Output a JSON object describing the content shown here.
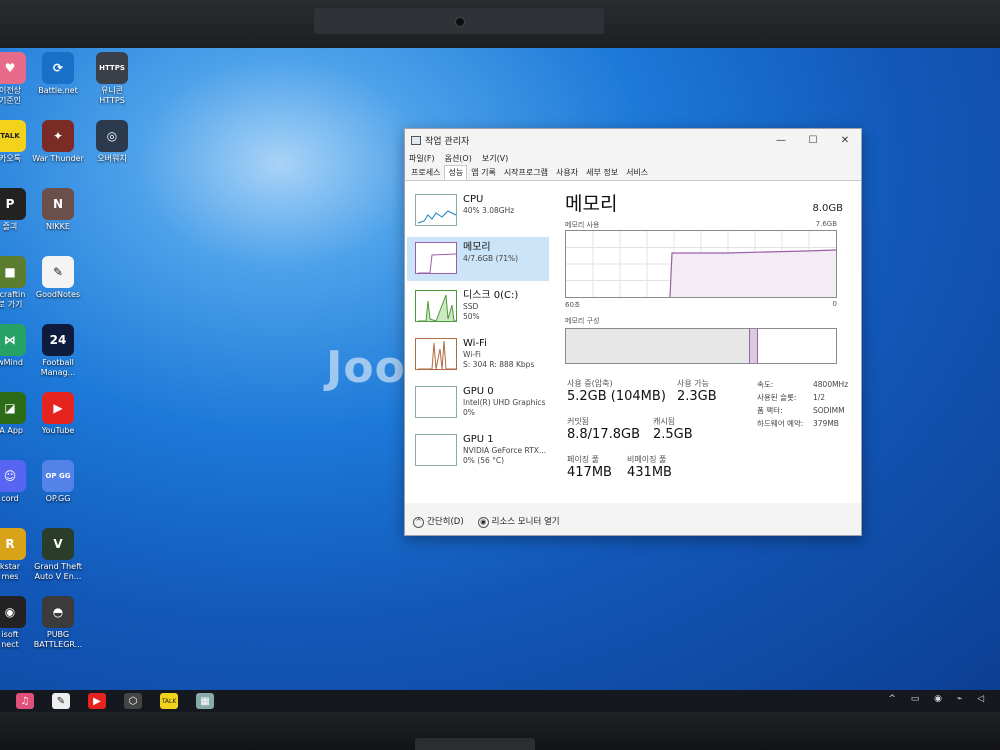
{
  "desktop": {
    "icons": [
      {
        "label": "이전상\n기준인",
        "color": "#e96b8c",
        "glyph": "♥"
      },
      {
        "label": "Battle.net",
        "color": "#1a70c6",
        "glyph": "⟳"
      },
      {
        "label": "유니콘\nHTTPS",
        "color": "#3a3f49",
        "glyph": "HTTPS"
      },
      {
        "label": "카오톡",
        "color": "#f3d21b",
        "glyph": "TALK"
      },
      {
        "label": "War Thunder",
        "color": "#7a2b25",
        "glyph": "✦"
      },
      {
        "label": "오버워치",
        "color": "#2c3a4d",
        "glyph": "◎"
      },
      {
        "label": "즐긔",
        "color": "#222",
        "glyph": "P"
      },
      {
        "label": "NIKKE",
        "color": "#6b4f4a",
        "glyph": "N"
      },
      {
        "label": "ecraftin\n로 가기",
        "color": "#5a7d2f",
        "glyph": "■"
      },
      {
        "label": "GoodNotes",
        "color": "#f4f4f4",
        "glyph": "✎"
      },
      {
        "label": "wMind",
        "color": "#26a267",
        "glyph": "⋈"
      },
      {
        "label": "Football\nManag...",
        "color": "#0f1b3d",
        "glyph": "24"
      },
      {
        "label": "IA App",
        "color": "#2c6b18",
        "glyph": "◪"
      },
      {
        "label": "YouTube",
        "color": "#e52420",
        "glyph": "▶"
      },
      {
        "label": "cord",
        "color": "#5865f2",
        "glyph": "☺"
      },
      {
        "label": "OP.GG",
        "color": "#5383e8",
        "glyph": "OP\nGG"
      },
      {
        "label": "kstar\nmes",
        "color": "#d8a318",
        "glyph": "R"
      },
      {
        "label": "Grand Theft\nAuto V En...",
        "color": "#2a3c2a",
        "glyph": "V"
      },
      {
        "label": "isoft\nnect",
        "color": "#222",
        "glyph": "◉"
      },
      {
        "label": "PUBG\nBATTLEGR...",
        "color": "#3b3b3b",
        "glyph": "◓"
      }
    ]
  },
  "watermark": "Joongnara",
  "task_manager": {
    "title": "작업 관리자",
    "controls": {
      "minimize": "—",
      "maximize": "☐",
      "close": "✕"
    },
    "menu": [
      "파일(F)",
      "옵션(O)",
      "보기(V)"
    ],
    "tabs": [
      "프로세스",
      "성능",
      "앱 기록",
      "시작프로그램",
      "사용자",
      "세부 정보",
      "서비스"
    ],
    "active_tab": "성능",
    "sidebar": [
      {
        "name": "CPU",
        "sub1": "40% 3.08GHz",
        "sub2": ""
      },
      {
        "name": "메모리",
        "sub1": "4/7.6GB (71%)",
        "sub2": ""
      },
      {
        "name": "디스크 0(C:)",
        "sub1": "SSD",
        "sub2": "50%"
      },
      {
        "name": "Wi-Fi",
        "sub1": "Wi-Fi",
        "sub2": "S: 304  R: 888 Kbps"
      },
      {
        "name": "GPU 0",
        "sub1": "Intel(R) UHD Graphics",
        "sub2": "0%"
      },
      {
        "name": "GPU 1",
        "sub1": "NVIDIA GeForce RTX...",
        "sub2": "0% (56 °C)"
      }
    ],
    "memory": {
      "title": "메모리",
      "total": "8.0GB",
      "usage_label": "메모리 사용",
      "usage_max": "7.6GB",
      "time_left": "60초",
      "time_right": "0",
      "composition_label": "메모리 구성",
      "composition": {
        "in_use_fraction": 0.68,
        "modified_fraction": 0.03
      },
      "in_use_label": "사용 중(압축)",
      "in_use_value": "5.2GB (104MB)",
      "available_label": "사용 가능",
      "available_value": "2.3GB",
      "committed_label": "커밋됨",
      "committed_value": "8.8/17.8GB",
      "cached_label": "캐시됨",
      "cached_value": "2.5GB",
      "paged_label": "페이징 풀",
      "paged_value": "417MB",
      "nonpaged_label": "비페이징 풀",
      "nonpaged_value": "431MB",
      "details": [
        {
          "k": "속도:",
          "v": "4800MHz"
        },
        {
          "k": "사용된 슬롯:",
          "v": "1/2"
        },
        {
          "k": "폼 팩터:",
          "v": "SODIMM"
        },
        {
          "k": "하드웨어 예약:",
          "v": "379MB"
        }
      ]
    },
    "footer": {
      "collapse": "간단히(D)",
      "resource_monitor": "리소스 모니터 열기"
    }
  },
  "taskbar": {
    "items": [
      {
        "name": "itunes",
        "glyph": "♫",
        "color": "#e0507a"
      },
      {
        "name": "notes",
        "glyph": "✎",
        "color": "#eeeeee"
      },
      {
        "name": "youtube",
        "glyph": "▶",
        "color": "#e52420"
      },
      {
        "name": "app",
        "glyph": "⬡",
        "color": "#444"
      },
      {
        "name": "kakaotalk",
        "glyph": "TALK",
        "color": "#f3d21b"
      },
      {
        "name": "task-manager",
        "glyph": "▦",
        "color": "#8aa"
      }
    ],
    "tray": "^ ▭ ◉ ⌁ ◁"
  }
}
